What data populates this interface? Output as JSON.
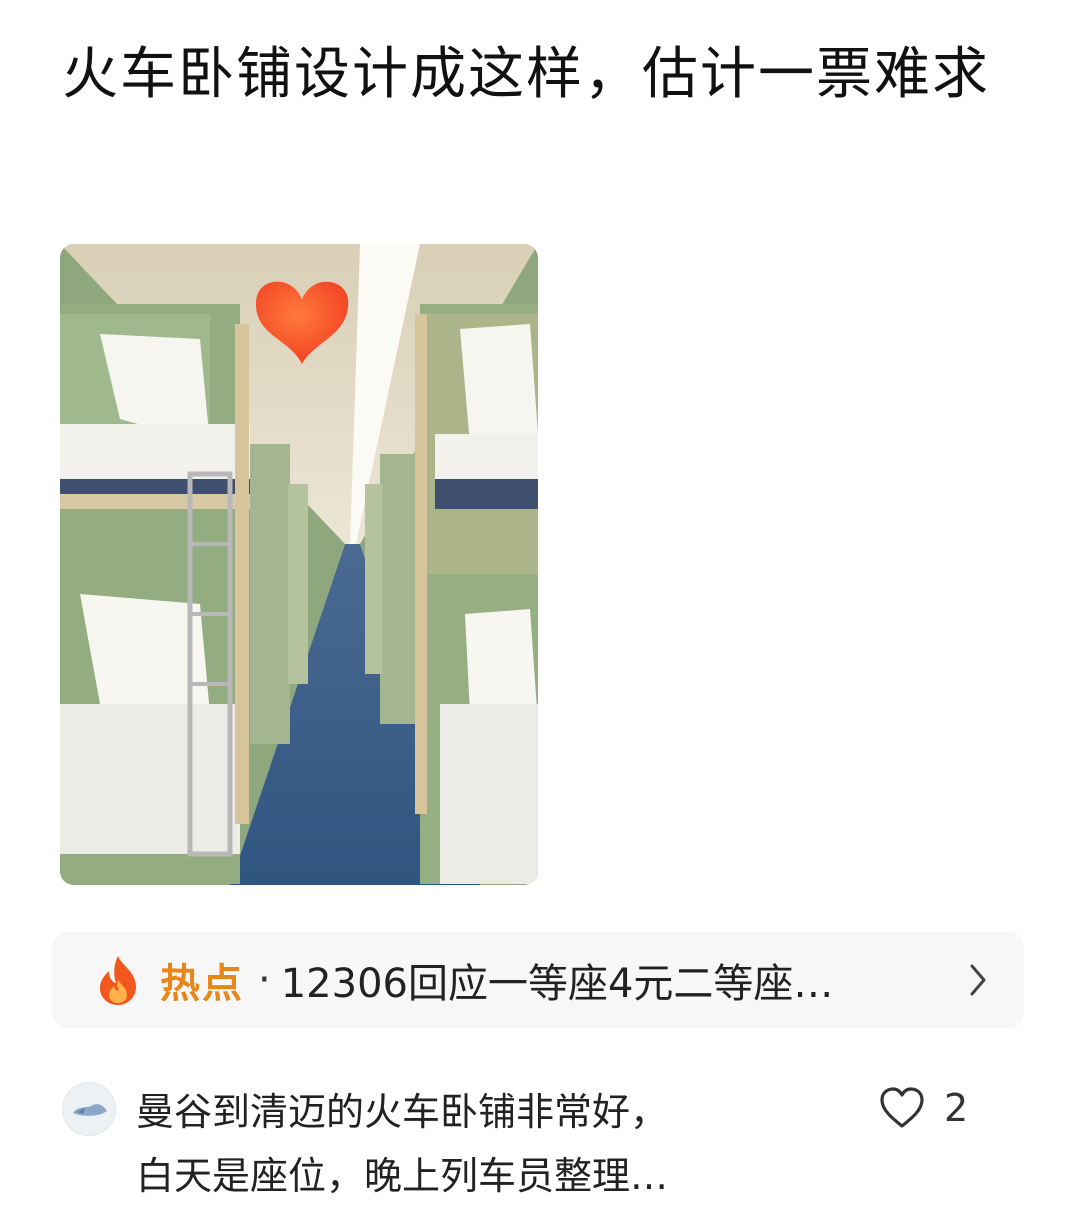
{
  "post": {
    "title": "火车卧铺设计成这样，估计一票难求",
    "image": {
      "subject": "train-sleeper-corridor",
      "sticker": "heart-icon"
    }
  },
  "hot_topic": {
    "icon": "flame-icon",
    "tag": "热点",
    "separator": "·",
    "text": "12306回应一等座4元二等座…",
    "accent_color": "#e8861a"
  },
  "comment": {
    "text_line1": "曼谷到清迈的火车卧铺非常好，",
    "text_line2": "白天是座位，晚上列车员整理…",
    "likes": "2"
  }
}
